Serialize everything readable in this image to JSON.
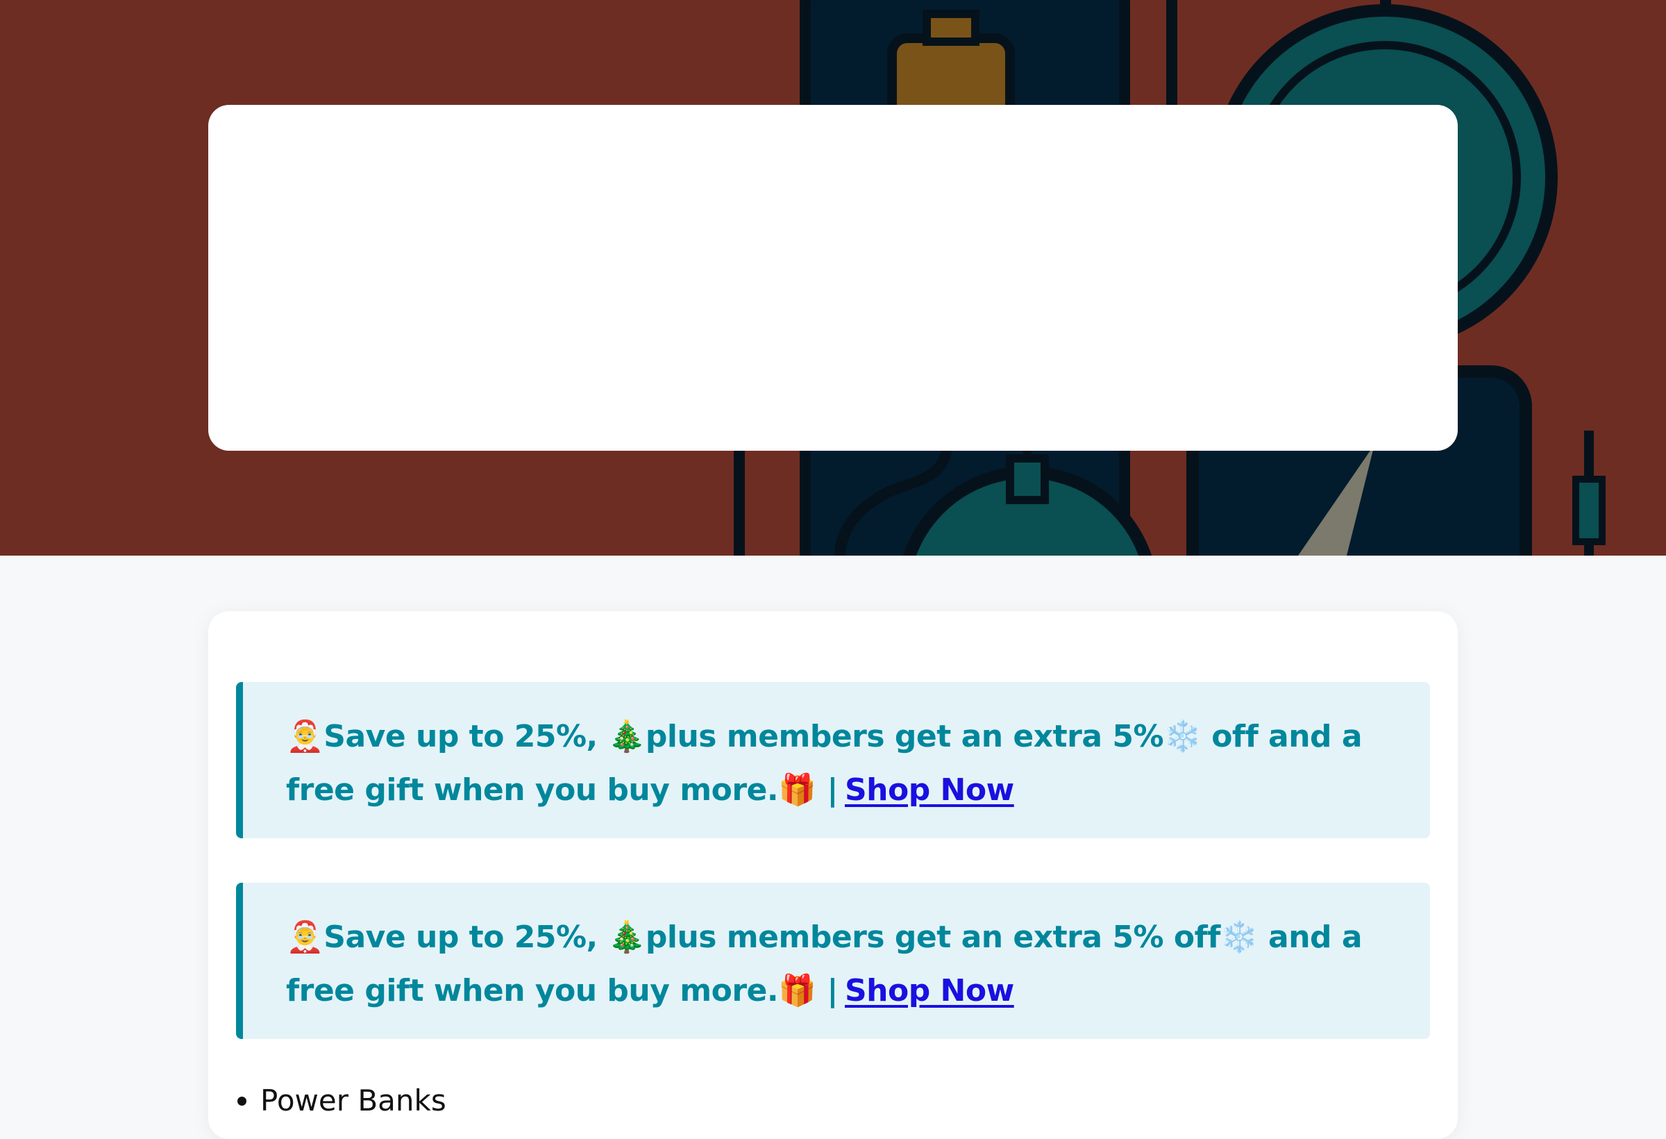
{
  "hero": {
    "background_color": "#6e2d23",
    "illustration": "power-bank-and-gauges-illustration"
  },
  "promos": [
    {
      "icon_santa": "🤶",
      "text_a": "Save up to 25%, ",
      "icon_tree": "🎄",
      "text_b": "plus members get an extra 5%",
      "icon_snow": "❄️",
      "text_c": " off and a free gift when you buy more.",
      "icon_gift": "🎁",
      "separator": "|",
      "link_label": "Shop Now"
    },
    {
      "icon_santa": "🤶",
      "text_a": "Save up to 25%, ",
      "icon_tree": "🎄",
      "text_b": "plus members get an extra 5% off",
      "icon_snow": "❄️",
      "text_c": " and a free gift when you buy more.",
      "icon_gift": "🎁",
      "separator": "|",
      "link_label": "Shop Now"
    }
  ],
  "categories": [
    "Power Banks"
  ],
  "colors": {
    "accent": "#00879c",
    "promo_bg": "#e4f3f8",
    "link": "#1a10e0"
  }
}
